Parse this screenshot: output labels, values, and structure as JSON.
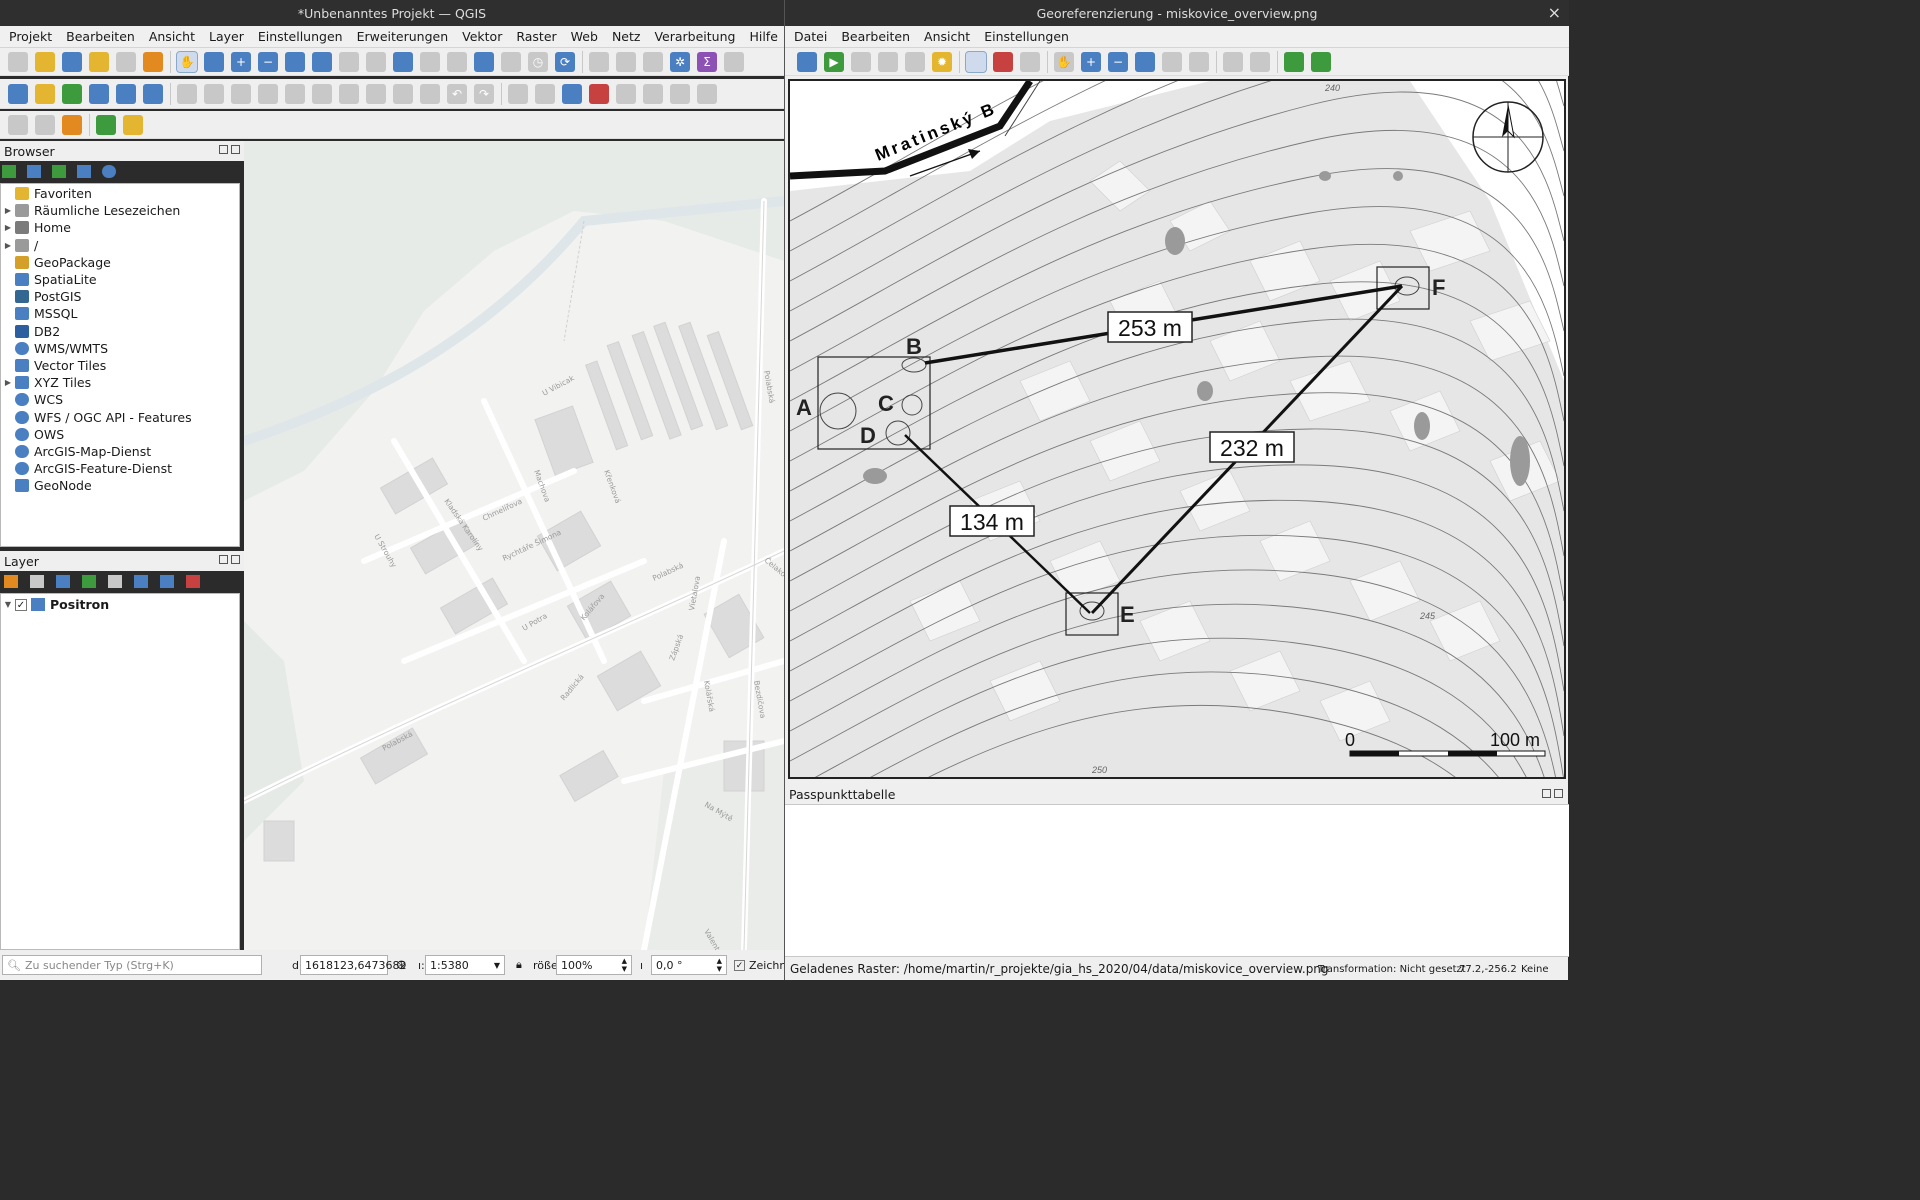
{
  "main_window": {
    "title": "*Unbenanntes Projekt — QGIS",
    "menu": [
      "Projekt",
      "Bearbeiten",
      "Ansicht",
      "Layer",
      "Einstellungen",
      "Erweiterungen",
      "Vektor",
      "Raster",
      "Web",
      "Netz",
      "Verarbeitung",
      "Hilfe"
    ]
  },
  "browser": {
    "title": "Browser",
    "items": [
      {
        "label": "Favoriten",
        "icon": "star-icon",
        "expand": false
      },
      {
        "label": "Räumliche Lesezeichen",
        "icon": "bookmark-icon",
        "expand": true
      },
      {
        "label": "Home",
        "icon": "home-icon",
        "expand": true
      },
      {
        "label": "/",
        "icon": "folder-icon",
        "expand": true
      },
      {
        "label": "GeoPackage",
        "icon": "geopackage-icon",
        "expand": false
      },
      {
        "label": "SpatiaLite",
        "icon": "feather-icon",
        "expand": false
      },
      {
        "label": "PostGIS",
        "icon": "elephant-icon",
        "expand": false
      },
      {
        "label": "MSSQL",
        "icon": "mssql-icon",
        "expand": false
      },
      {
        "label": "DB2",
        "icon": "db2-icon",
        "expand": false
      },
      {
        "label": "WMS/WMTS",
        "icon": "globe-icon",
        "expand": false
      },
      {
        "label": "Vector Tiles",
        "icon": "grid-icon",
        "expand": false
      },
      {
        "label": "XYZ Tiles",
        "icon": "grid-icon",
        "expand": true
      },
      {
        "label": "WCS",
        "icon": "globe-icon",
        "expand": false
      },
      {
        "label": "WFS / OGC API - Features",
        "icon": "globe-icon",
        "expand": false
      },
      {
        "label": "OWS",
        "icon": "globe-icon",
        "expand": false
      },
      {
        "label": "ArcGIS-Map-Dienst",
        "icon": "globe-icon",
        "expand": false
      },
      {
        "label": "ArcGIS-Feature-Dienst",
        "icon": "globe-icon",
        "expand": false
      },
      {
        "label": "GeoNode",
        "icon": "geonode-icon",
        "expand": false
      }
    ]
  },
  "layers": {
    "title": "Layer",
    "items": [
      {
        "label": "Positron",
        "checked": true
      }
    ]
  },
  "map_streets": [
    "U Vibicak",
    "Machova",
    "Křenková",
    "Kladská Karolíny",
    "U Strouhy",
    "Chmelířova",
    "Rychtáře Šimona",
    "U Potra",
    "Polabská",
    "Kolářova",
    "Radlická",
    "Polabská",
    "Zápská",
    "Kolářská",
    "Víetalova",
    "Na Mýtě",
    "Čelakovická",
    "Polabská",
    "Bezdičova",
    "Valentova"
  ],
  "statusbar_main": {
    "search_placeholder": "Zu suchender Typ (Strg+K)",
    "coord_label": "d",
    "coord_value": "1618123,6473682",
    "scale_label": "ı:",
    "scale_value": "1:5380",
    "magnifier_label": "rößе",
    "magnifier_value": "100%",
    "rotation_label": "ı",
    "rotation_value": "0,0 °",
    "render_label": "Zeichne"
  },
  "georef": {
    "title": "Georeferenzierung - miskovice_overview.png",
    "close": "×",
    "menu": [
      "Datei",
      "Bearbeiten",
      "Ansicht",
      "Einstellungen"
    ],
    "image": {
      "road_label": "Mratinský B",
      "points": {
        "A": "A",
        "B": "B",
        "C": "C",
        "D": "D",
        "E": "E",
        "F": "F"
      },
      "distances": {
        "bf": "253 m",
        "de": "134 m",
        "ef": "232 m"
      },
      "contours": {
        "c240": "240",
        "c245": "245",
        "c250": "250"
      },
      "scale_zero": "0",
      "scale_end": "100 m"
    },
    "gcp_table_title": "Passpunkttabelle",
    "status_left": "Geladenes Raster: /home/martin/r_projekte/gia_hs_2020/04/data/miskovice_overview.png",
    "status_transform": "Transformation: Nicht gesetzt",
    "status_coords": "77.2,-256.2",
    "status_none": "Keine"
  }
}
